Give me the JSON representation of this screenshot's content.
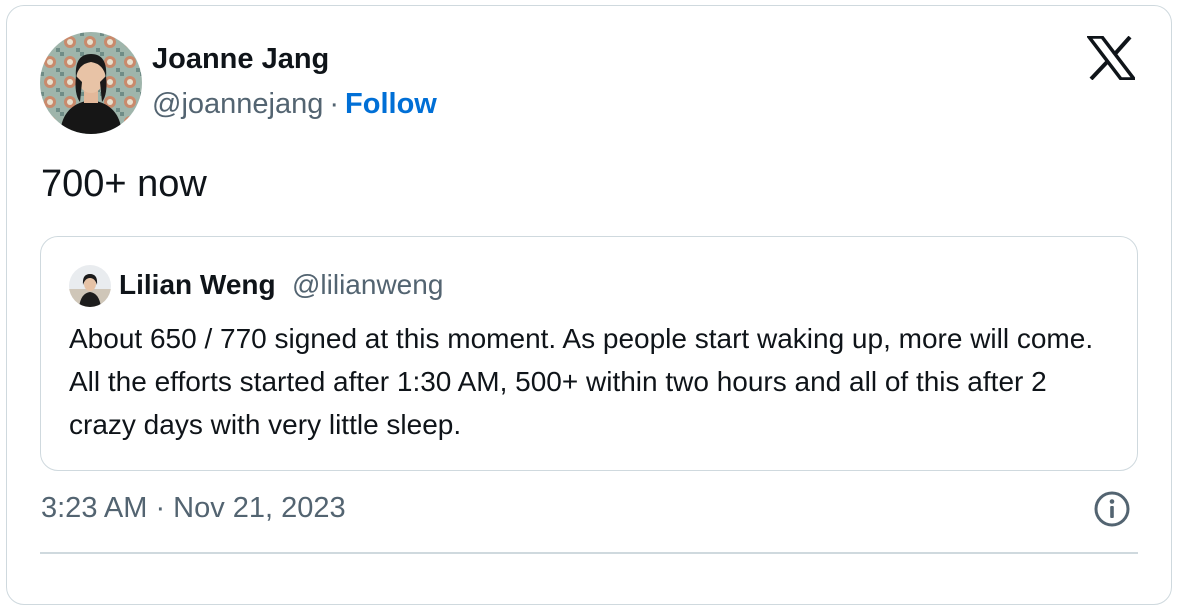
{
  "tweet": {
    "author": {
      "name": "Joanne Jang",
      "handle": "@joannejang",
      "separator": "·",
      "follow_label": "Follow",
      "avatar_icon": "profile-photo"
    },
    "text": "700+ now",
    "quoted": {
      "author_name": "Lilian Weng",
      "author_handle": "@lilianweng",
      "text": "About 650 / 770 signed at this moment. As people start waking up, more will come. All the efforts started after 1:30 AM, 500+ within two hours and all of this after 2 crazy days with very little sleep."
    },
    "timestamp": "3:23 AM · Nov 21, 2023",
    "icons": {
      "brand": "x-logo-icon",
      "info": "info-icon"
    },
    "colors": {
      "text": "#0f1419",
      "secondary": "#536471",
      "link": "#006fd6",
      "border": "#cfd9de"
    }
  }
}
